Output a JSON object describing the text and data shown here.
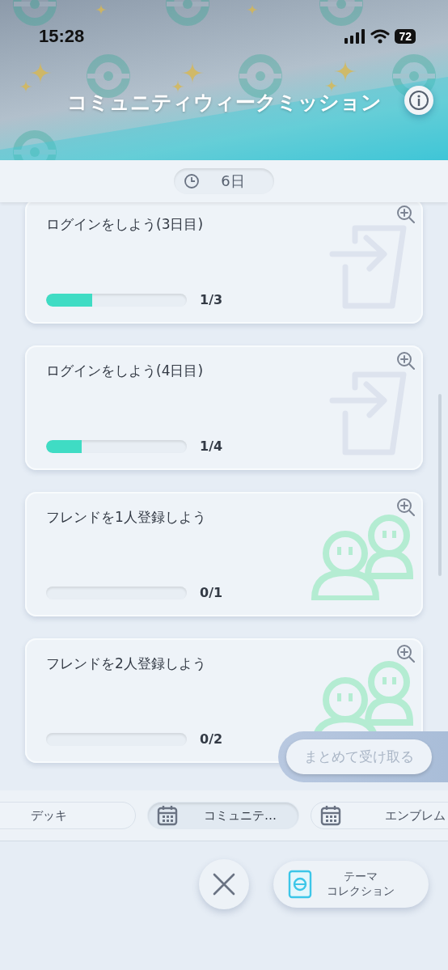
{
  "status_bar": {
    "time": "15:28",
    "battery": "72"
  },
  "header": {
    "title": "コミュニティウィークミッション"
  },
  "timer": {
    "remaining": "6日"
  },
  "missions": [
    {
      "title": "ログインをしよう(3日目)",
      "kind": "login",
      "level": 0.33,
      "progress": "1/3"
    },
    {
      "title": "ログインをしよう(4日目)",
      "kind": "login",
      "level": 0.25,
      "progress": "1/4"
    },
    {
      "title": "フレンドを1人登録しよう",
      "kind": "friend",
      "level": 0,
      "progress": "0/1"
    },
    {
      "title": "フレンドを2人登録しよう",
      "kind": "friend",
      "level": 0,
      "progress": "0/2"
    }
  ],
  "claim_all": {
    "label": "まとめて受け取る",
    "disabled": true
  },
  "tabs": [
    {
      "label": "デッキ",
      "selected": false,
      "icon": false
    },
    {
      "label": "コミュニテ…",
      "selected": true,
      "icon": true
    },
    {
      "label": "エンブレム",
      "selected": false,
      "icon": true
    }
  ],
  "theme_button": {
    "lines": [
      "テーマ",
      "コレクション"
    ]
  }
}
